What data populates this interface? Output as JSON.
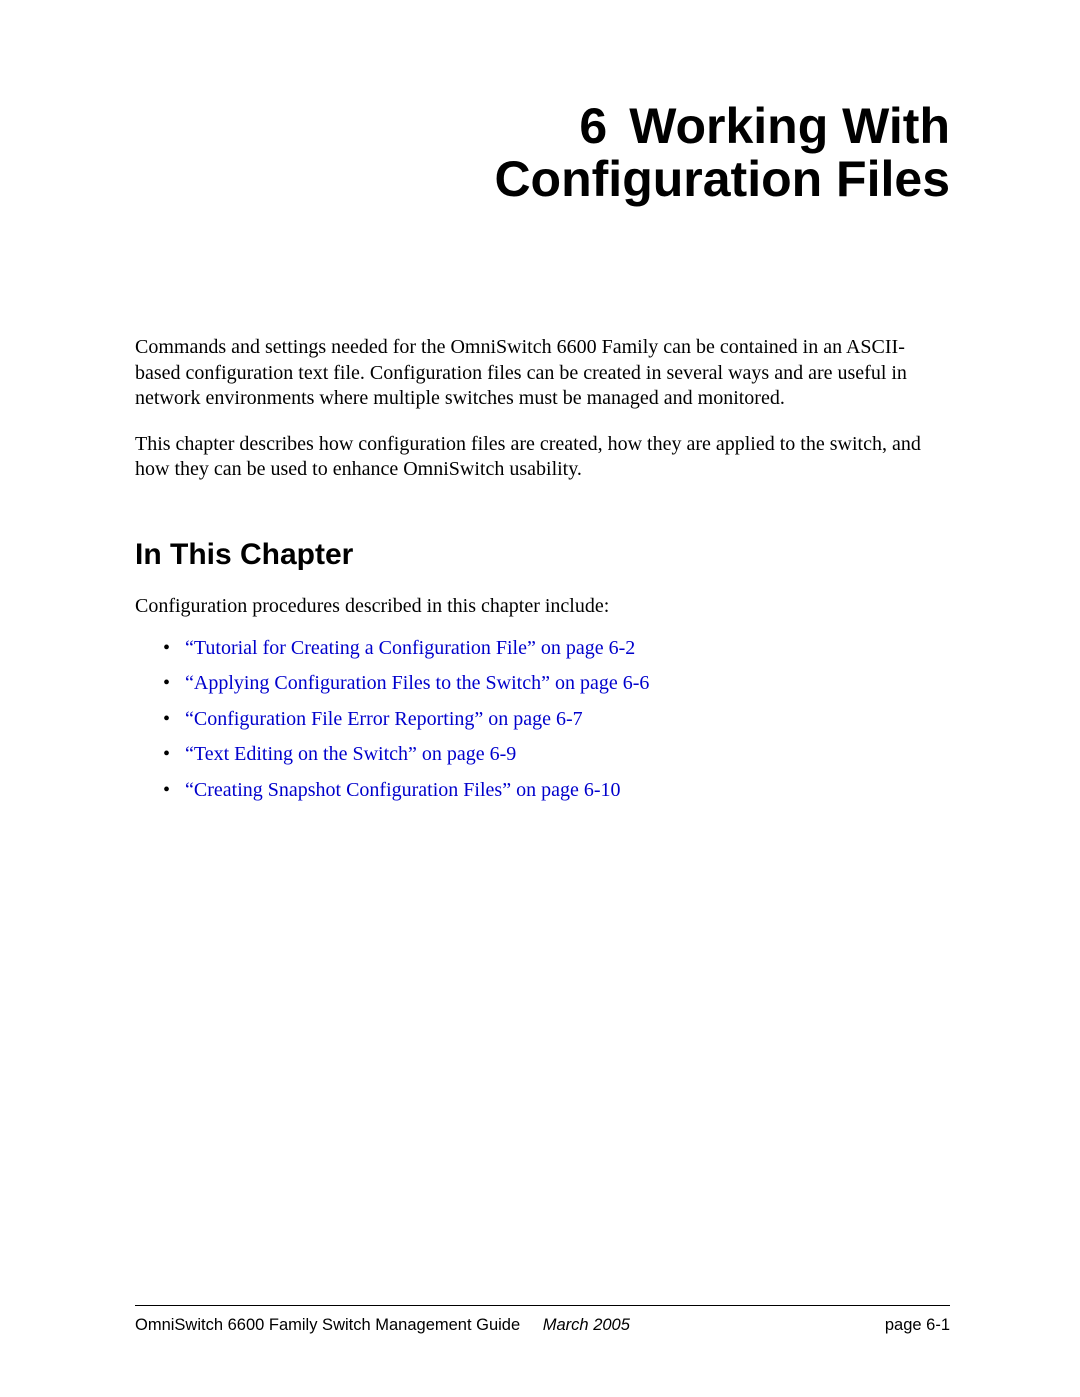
{
  "chapter": {
    "number": "6",
    "title_line1": "Working With",
    "title_line2": "Configuration Files"
  },
  "intro": {
    "p1": "Commands and settings needed for the OmniSwitch 6600 Family can be contained in an ASCII-based configuration text file. Configuration files can be created in several ways and are useful in network environments where multiple switches must be managed and monitored.",
    "p2": "This chapter describes how configuration files are created, how they are applied to the switch, and how they can be used to enhance OmniSwitch usability."
  },
  "section": {
    "heading": "In This Chapter",
    "lead": "Configuration procedures described in this chapter include:",
    "items": [
      "“Tutorial for Creating a Configuration File” on page 6-2",
      "“Applying Configuration Files to the Switch” on page 6-6",
      "“Configuration File Error Reporting” on page 6-7",
      "“Text Editing on the Switch” on page 6-9",
      "“Creating Snapshot Configuration Files” on page 6-10"
    ]
  },
  "footer": {
    "guide": "OmniSwitch 6600 Family Switch Management Guide",
    "date": "March 2005",
    "page": "page 6-1"
  }
}
